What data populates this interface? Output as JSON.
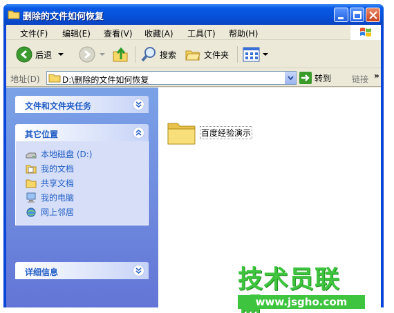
{
  "window": {
    "title": "删除的文件如何恢复"
  },
  "menu": [
    "文件(F)",
    "编辑(E)",
    "查看(V)",
    "收藏(A)",
    "工具(T)",
    "帮助(H)"
  ],
  "toolbar": {
    "back_label": "后退",
    "search_label": "搜索",
    "folders_label": "文件夹"
  },
  "address": {
    "label": "地址(D)",
    "value": "D:\\删除的文件如何恢复",
    "go_label": "转到",
    "links_label": "链接",
    "more": "»"
  },
  "taskpane": {
    "file_tasks_title": "文件和文件夹任务",
    "other_places_title": "其它位置",
    "places": [
      {
        "label": "本地磁盘 (D:)",
        "icon": "drive-icon"
      },
      {
        "label": "我的文档",
        "icon": "my-documents-icon"
      },
      {
        "label": "共享文档",
        "icon": "shared-folder-icon"
      },
      {
        "label": "我的电脑",
        "icon": "my-computer-icon"
      },
      {
        "label": "网上邻居",
        "icon": "network-icon"
      }
    ],
    "details_title": "详细信息"
  },
  "files": [
    {
      "name": "百度经验演示",
      "icon": "folder-icon"
    }
  ],
  "watermark": {
    "text": "技术员联盟",
    "url": "www.jsgho.com"
  },
  "colors": {
    "titlebar": "#0551d8",
    "taskpane_title": "#215dc6",
    "watermark": "#3ec43e"
  }
}
